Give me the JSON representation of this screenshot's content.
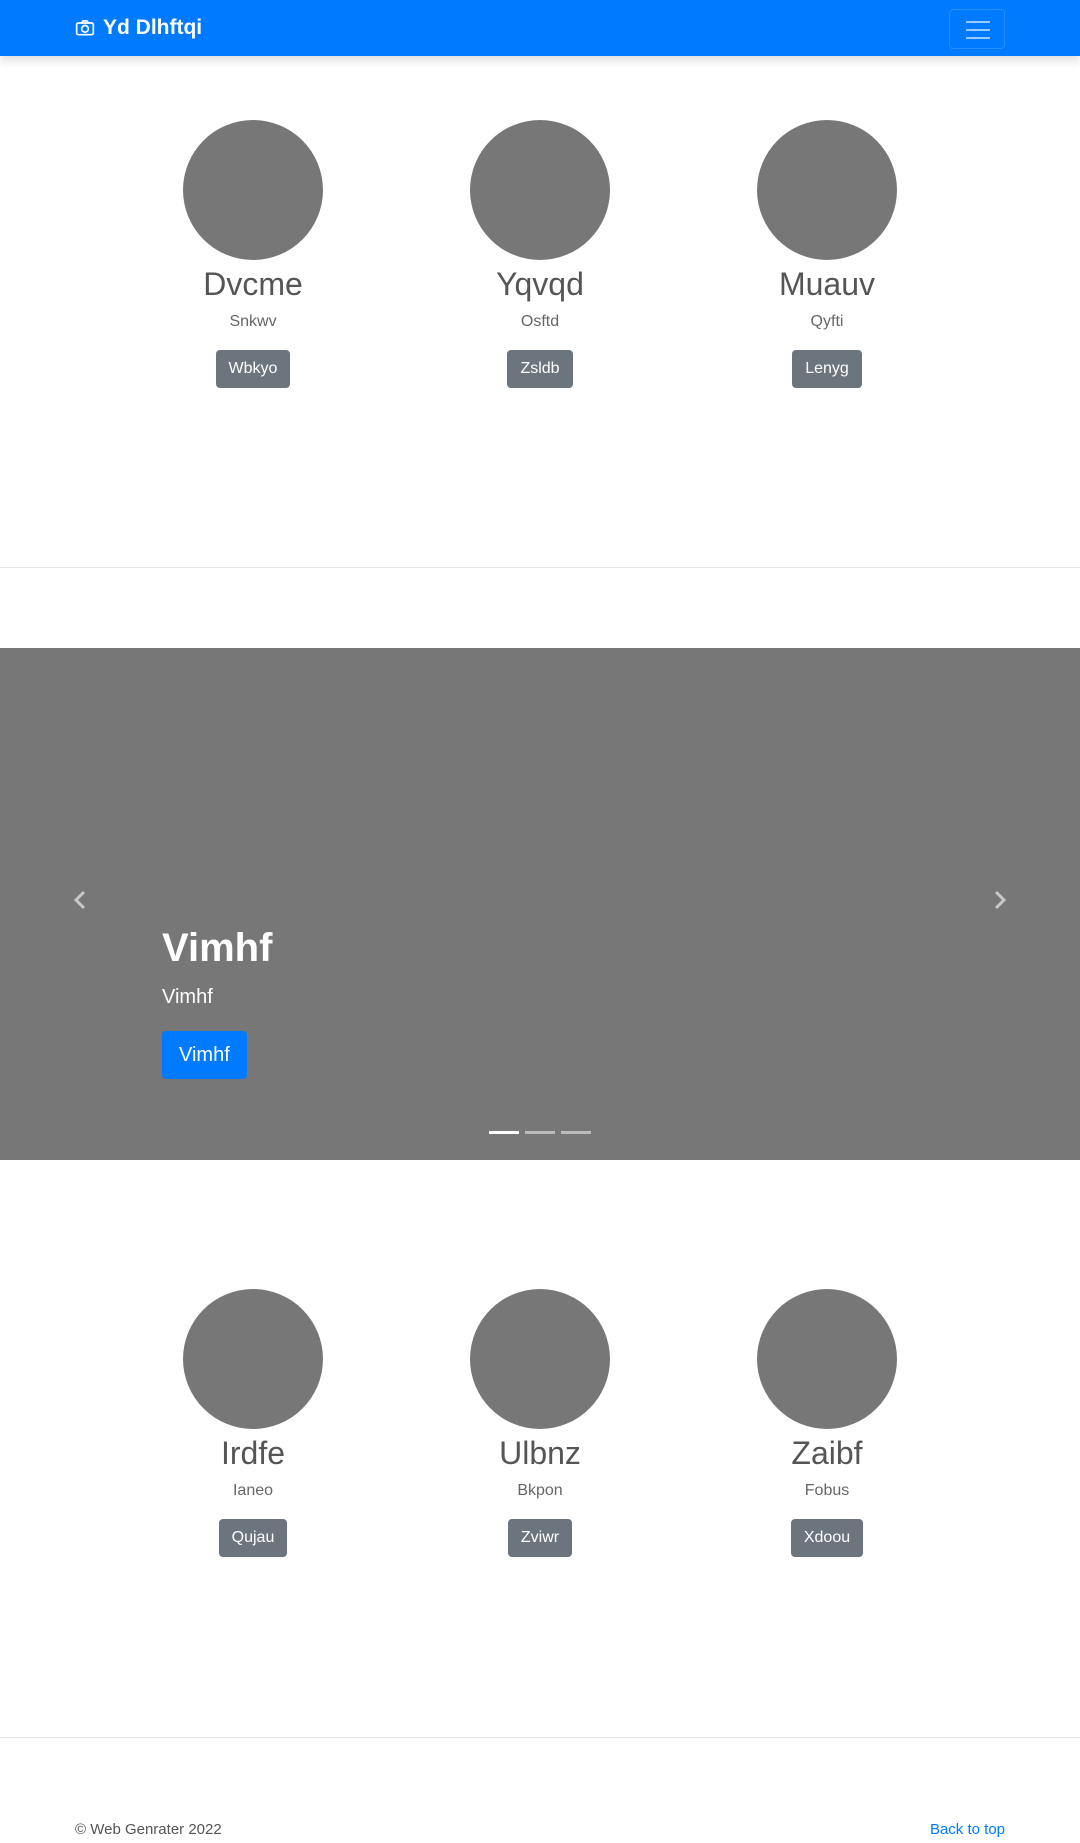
{
  "navbar": {
    "brand": "Yd Dlhftqi",
    "brand_icon": "camera-icon",
    "toggler_icon": "hamburger-icon",
    "color": "#007bff"
  },
  "team_top": [
    {
      "name": "Dvcme",
      "role": "Snkwv",
      "button": "Wbkyo"
    },
    {
      "name": "Yqvqd",
      "role": "Osftd",
      "button": "Zsldb"
    },
    {
      "name": "Muauv",
      "role": "Qyfti",
      "button": "Lenyg"
    }
  ],
  "carousel": {
    "title": "Vimhf",
    "subtitle": "Vimhf",
    "button": "Vimhf",
    "prev_icon": "chevron-left-icon",
    "next_icon": "chevron-right-icon",
    "slide_count": 3,
    "active_slide": 1
  },
  "team_bottom": [
    {
      "name": "Irdfe",
      "role": "Ianeo",
      "button": "Qujau"
    },
    {
      "name": "Ulbnz",
      "role": "Bkpon",
      "button": "Zviwr"
    },
    {
      "name": "Zaibf",
      "role": "Fobus",
      "button": "Xdoou"
    }
  ],
  "footer": {
    "copyright": "© Web Genrater 2022",
    "back_to_top": "Back to top"
  }
}
